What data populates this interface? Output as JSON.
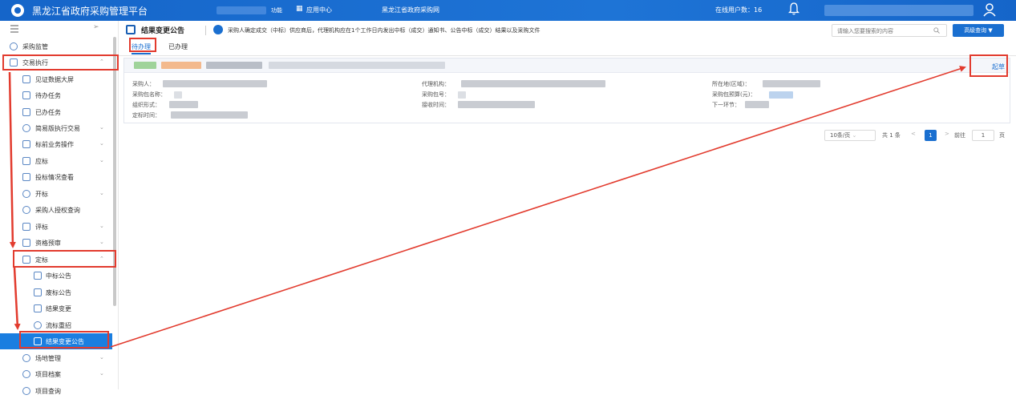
{
  "topbar": {
    "app_title": "黑龙江省政府采购管理平台",
    "small_text": "功能",
    "app_center": "应用中心",
    "site_name": "黑龙江省政府采购网",
    "online_users": "在线用户数：16"
  },
  "sidebar": {
    "items": [
      {
        "label": "采购监管"
      },
      {
        "label": "交易执行"
      },
      {
        "label": "见证数据大屏"
      },
      {
        "label": "待办任务"
      },
      {
        "label": "已办任务"
      },
      {
        "label": "简易版执行交易"
      },
      {
        "label": "标前业务操作"
      },
      {
        "label": "应标"
      },
      {
        "label": "投标情况查看"
      },
      {
        "label": "开标"
      },
      {
        "label": "采购人授权查询"
      },
      {
        "label": "评标"
      },
      {
        "label": "资格预审"
      },
      {
        "label": "定标"
      },
      {
        "label": "中标公告"
      },
      {
        "label": "废标公告"
      },
      {
        "label": "结果变更"
      },
      {
        "label": "流标重招"
      },
      {
        "label": "结果变更公告"
      },
      {
        "label": "场地管理"
      },
      {
        "label": "项目档案"
      },
      {
        "label": "项目查询"
      }
    ]
  },
  "page": {
    "title": "结果变更公告",
    "notice": "采购人确定成交（中标）供应商后，代理机构应在1个工作日内发出中标（成交）通知书、公告中标（成交）结果以及采购文件",
    "search_placeholder": "请输入您要搜索的内容",
    "advanced_search": "高级查询"
  },
  "tabs": [
    {
      "label": "待办理"
    },
    {
      "label": "已办理"
    }
  ],
  "card": {
    "draft_label": "起草",
    "fields": {
      "purchaser": "采购人：",
      "agency": "代理机构：",
      "region": "所在地(区域)：",
      "package_name": "采购包名称：",
      "package_no": "采购包号：",
      "package_budget": "采购包预算(元)：",
      "org_form": "组织形式：",
      "receive_time": "接收时间：",
      "next_step": "下一环节：",
      "award_time": "定标时间："
    }
  },
  "pager": {
    "page_size": "10条/页",
    "total": "共 1 条",
    "current_page": "1",
    "goto_label": "前往",
    "goto_value": "1",
    "page_unit": "页"
  },
  "colors": {
    "primary": "#1a6fd0",
    "topbar": "#1565c9",
    "highlight_red": "#e23b2e"
  }
}
